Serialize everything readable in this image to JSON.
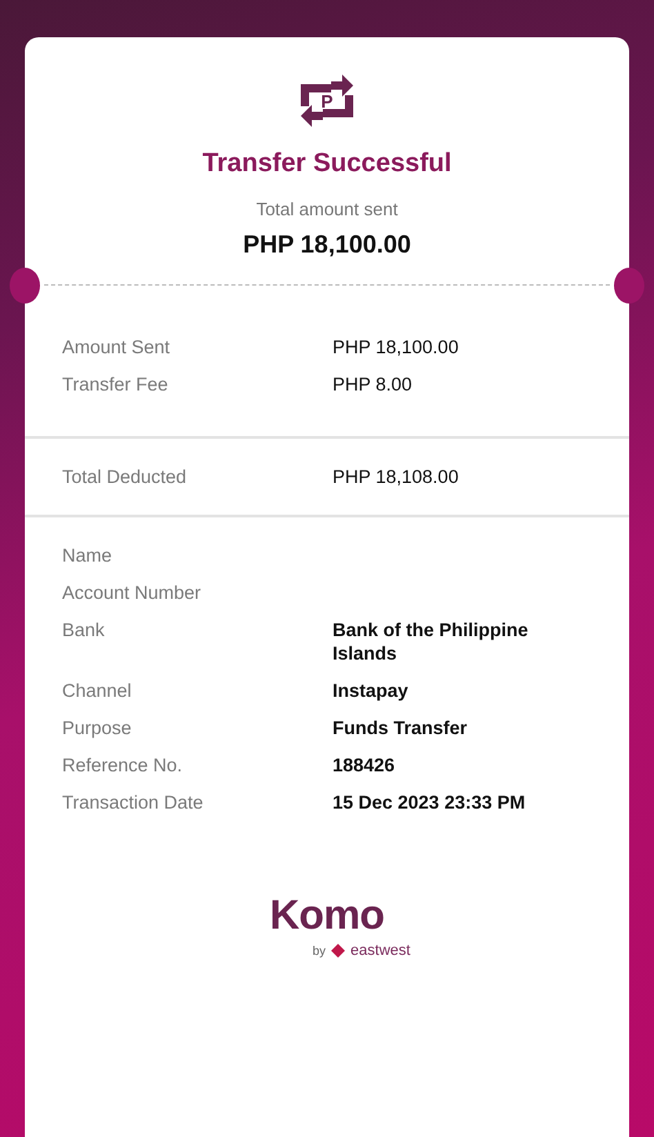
{
  "header": {
    "icon_letter": "P",
    "title": "Transfer Successful",
    "subtitle": "Total amount sent",
    "amount": "PHP 18,100.00"
  },
  "sections": [
    {
      "rows": [
        {
          "label": "Amount Sent",
          "value": "PHP 18,100.00"
        },
        {
          "label": "Transfer Fee",
          "value": "PHP 8.00"
        }
      ]
    },
    {
      "rows": [
        {
          "label": "Total Deducted",
          "value": "PHP 18,108.00"
        }
      ]
    },
    {
      "rows": [
        {
          "label": "Name"
        },
        {
          "label": "Account Number"
        },
        {
          "label": "Bank",
          "value": "Bank of the Philippine Islands"
        },
        {
          "label": "Channel",
          "value": "Instapay"
        },
        {
          "label": "Purpose",
          "value": "Funds Transfer"
        },
        {
          "label": "Reference No.",
          "value": "188426"
        },
        {
          "label": "Transaction Date",
          "value": "15 Dec 2023 23:33 PM"
        }
      ]
    }
  ],
  "logo": {
    "name": "Komo",
    "by": "by",
    "partner": "eastwest"
  }
}
